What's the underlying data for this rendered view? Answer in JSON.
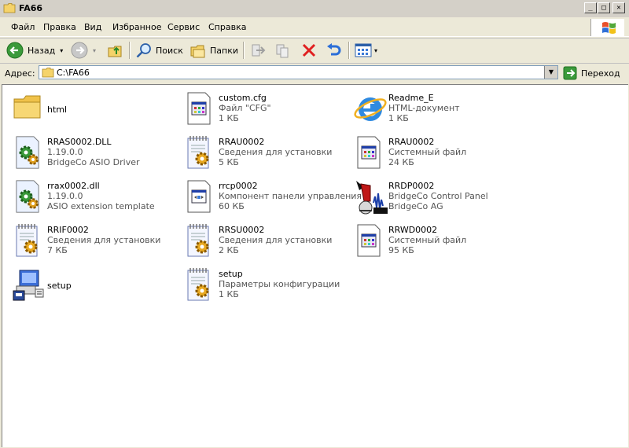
{
  "window": {
    "title": "FA66"
  },
  "menu": [
    "Файл",
    "Правка",
    "Вид",
    "Избранное",
    "Сервис",
    "Справка"
  ],
  "toolbar": {
    "back": "Назад",
    "search": "Поиск",
    "folders": "Папки"
  },
  "address": {
    "label": "Адрес:",
    "path": "C:\\FA66",
    "go": "Переход"
  },
  "files": [
    {
      "name": "html",
      "icon": "folder-icon",
      "lines": []
    },
    {
      "name": "custom.cfg",
      "icon": "cfg-file-icon",
      "lines": [
        "Файл \"CFG\"",
        "1 КБ"
      ]
    },
    {
      "name": "Readme_E",
      "icon": "internet-explorer-icon",
      "lines": [
        "HTML-документ",
        "1 КБ"
      ]
    },
    {
      "name": "RRAS0002.DLL",
      "icon": "dll-gear-icon",
      "lines": [
        "1.19.0.0",
        "BridgeCo ASIO Driver"
      ]
    },
    {
      "name": "RRAU0002",
      "icon": "setup-info-icon",
      "lines": [
        "Сведения для установки",
        "5 КБ"
      ]
    },
    {
      "name": "RRAU0002",
      "icon": "system-file-icon",
      "lines": [
        "Системный файл",
        "24 КБ"
      ]
    },
    {
      "name": "rrax0002.dll",
      "icon": "dll-gear-icon",
      "lines": [
        "1.19.0.0",
        "ASIO extension template"
      ]
    },
    {
      "name": "rrcp0002",
      "icon": "control-panel-item-icon",
      "lines": [
        "Компонент панели управления",
        "60 КБ"
      ]
    },
    {
      "name": "RRDP0002",
      "icon": "bridgeco-app-icon",
      "lines": [
        "BridgeCo Control Panel",
        "BridgeCo AG"
      ]
    },
    {
      "name": "RRIF0002",
      "icon": "setup-info-icon",
      "lines": [
        "Сведения для установки",
        "7 КБ"
      ]
    },
    {
      "name": "RRSU0002",
      "icon": "setup-info-icon",
      "lines": [
        "Сведения для установки",
        "2 КБ"
      ]
    },
    {
      "name": "RRWD0002",
      "icon": "system-file-icon",
      "lines": [
        "Системный файл",
        "95 КБ"
      ]
    },
    {
      "name": "setup",
      "icon": "setup-installer-icon",
      "lines": []
    },
    {
      "name": "setup",
      "icon": "setup-info-icon",
      "lines": [
        "Параметры конфигурации",
        "1 КБ"
      ]
    }
  ]
}
